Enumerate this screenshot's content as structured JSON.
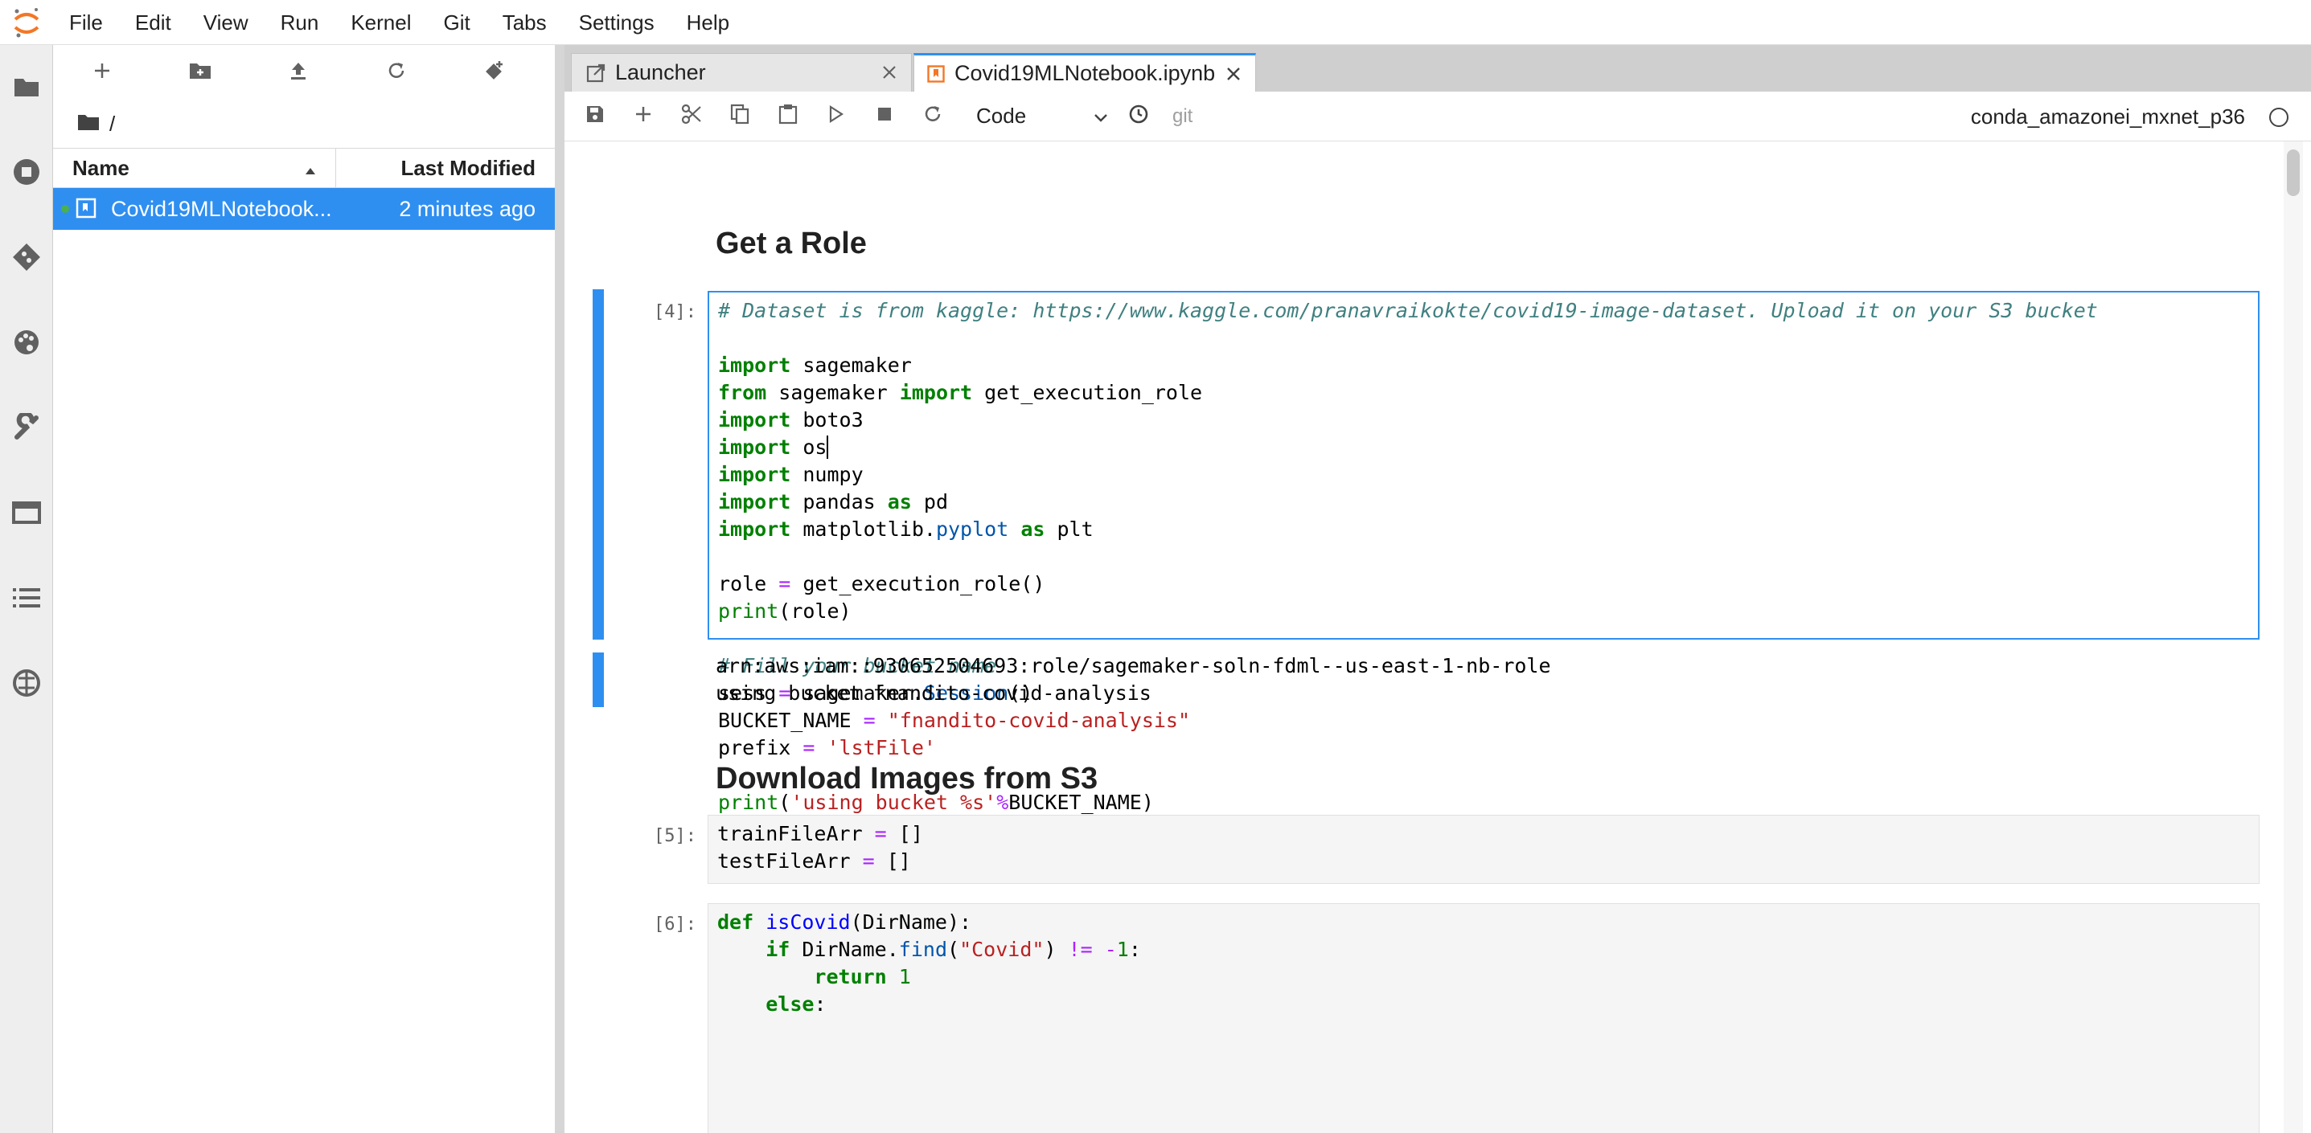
{
  "menu": [
    "File",
    "Edit",
    "View",
    "Run",
    "Kernel",
    "Git",
    "Tabs",
    "Settings",
    "Help"
  ],
  "filebrowser": {
    "breadcrumb": "/",
    "columns": {
      "name": "Name",
      "modified": "Last Modified"
    },
    "files": [
      {
        "name": "Covid19MLNotebook...",
        "modified": "2 minutes ago"
      }
    ]
  },
  "tabs": [
    {
      "label": "Launcher",
      "icon": "launcher-icon"
    },
    {
      "label": "Covid19MLNotebook.ipynb",
      "icon": "notebook-icon"
    }
  ],
  "toolbar": {
    "cell_type": "Code",
    "git_label": "git",
    "kernel_name": "conda_amazonei_mxnet_p36"
  },
  "cells": {
    "heading1": "Get a Role",
    "cell4_prompt": "[4]:",
    "cell4_output": "arn:aws:iam::930652504693:role/sagemaker-soln-fdml--us-east-1-nb-role\nusing bucket fnandito-covid-analysis",
    "heading2": "Download Images from S3",
    "cell5_prompt": "[5]:",
    "cell6_prompt": "[6]:"
  },
  "colors": {
    "accent": "#2f8ff0",
    "keyword": "#008000",
    "comment": "#408080",
    "string": "#ba2121",
    "operator": "#aa22ff"
  }
}
